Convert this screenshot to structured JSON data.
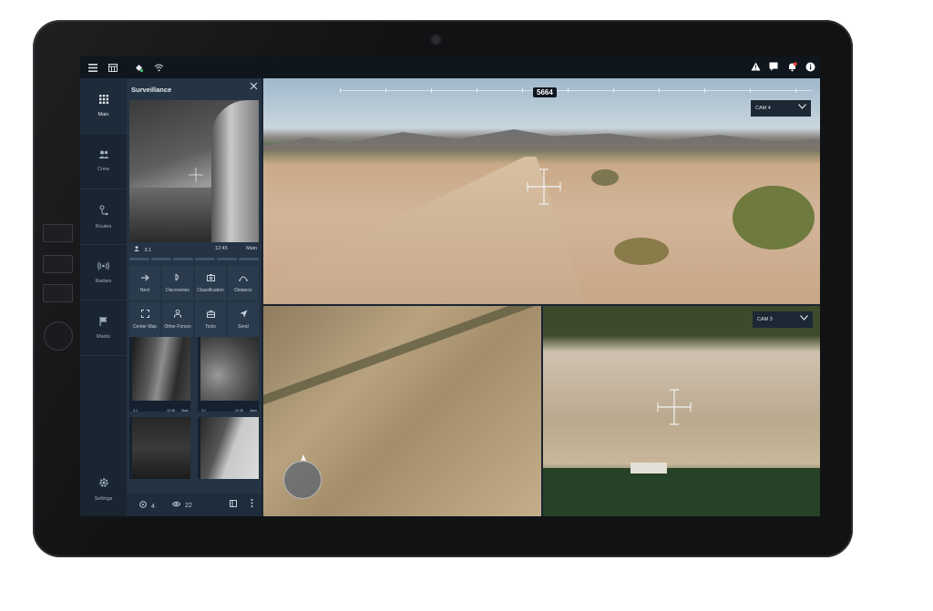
{
  "topbar": {
    "left_icons": [
      "menu-icon",
      "calendar-icon",
      "satellite-icon",
      "wifi-icon"
    ],
    "right_icons": [
      "warning-icon",
      "message-icon",
      "notification-icon",
      "info-icon"
    ]
  },
  "nav": {
    "items": [
      {
        "label": "Main",
        "icon": "grid-icon"
      },
      {
        "label": "Crew",
        "icon": "crew-icon"
      },
      {
        "label": "Routes",
        "icon": "route-icon"
      },
      {
        "label": "Radars",
        "icon": "radar-icon"
      },
      {
        "label": "Marks",
        "icon": "flag-icon"
      }
    ],
    "settings_label": "Settings"
  },
  "panel": {
    "title": "Surveillance",
    "feed": {
      "user": "3.1",
      "time": "12:45",
      "source": "Main"
    },
    "actions": [
      {
        "label": "Next",
        "icon": "arrow-right-icon"
      },
      {
        "label": "Discoveries",
        "icon": "discovery-icon"
      },
      {
        "label": "Classification",
        "icon": "classification-icon"
      },
      {
        "label": "Distance",
        "icon": "distance-icon"
      },
      {
        "label": "Center Map",
        "icon": "center-map-icon"
      },
      {
        "label": "Other Forces",
        "icon": "forces-icon"
      },
      {
        "label": "Tools",
        "icon": "tools-icon"
      },
      {
        "label": "Send",
        "icon": "send-icon"
      }
    ],
    "thumbnails": [
      {
        "user": "3.1",
        "time": "12:45",
        "source": "Main"
      },
      {
        "user": "3.1",
        "time": "12:45",
        "source": "Main"
      }
    ],
    "footer": {
      "pins": "4",
      "views": "22"
    }
  },
  "main_view": {
    "heading": "5664",
    "camera": "CAM 4"
  },
  "cam3_view": {
    "camera": "CAM 3"
  },
  "colors": {
    "screen_bg": "#1b2530",
    "panel_bg": "#243444",
    "topbar_bg": "#0f161e"
  }
}
